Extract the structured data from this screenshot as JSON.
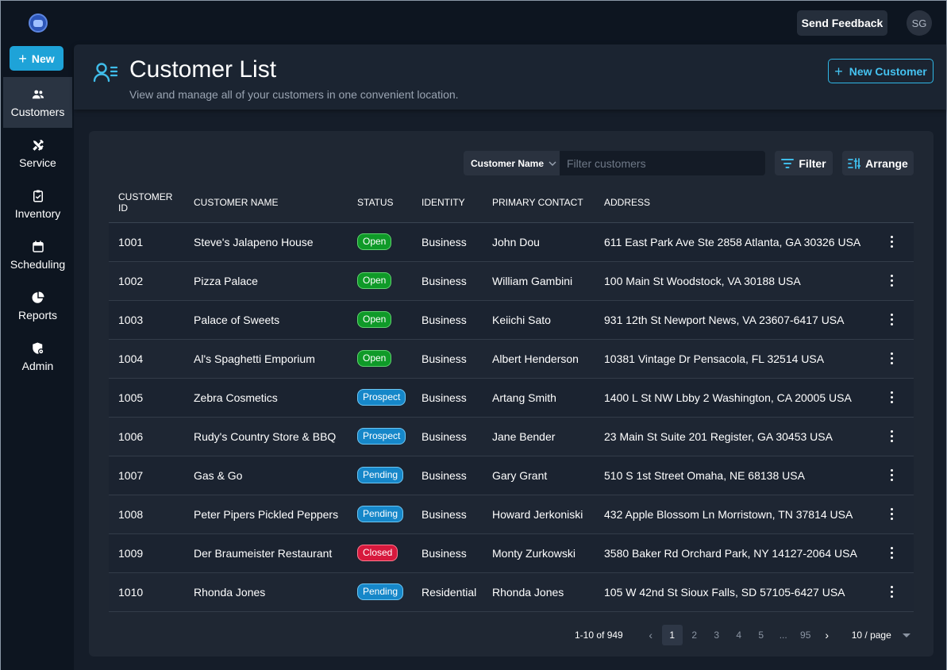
{
  "topbar": {
    "send_feedback": "Send Feedback",
    "avatar_initials": "SG"
  },
  "sidebar": {
    "new_button": "New",
    "items": [
      {
        "label": "Customers",
        "icon": "users-icon",
        "active": true
      },
      {
        "label": "Service",
        "icon": "tools-icon",
        "active": false
      },
      {
        "label": "Inventory",
        "icon": "clipboard-check-icon",
        "active": false
      },
      {
        "label": "Scheduling",
        "icon": "calendar-icon",
        "active": false
      },
      {
        "label": "Reports",
        "icon": "pie-chart-icon",
        "active": false
      },
      {
        "label": "Admin",
        "icon": "shield-gear-icon",
        "active": false
      }
    ]
  },
  "header": {
    "title": "Customer List",
    "subtitle": "View and manage all of your customers in one convenient location.",
    "new_customer": "New Customer"
  },
  "toolbar": {
    "search_field": "Customer Name",
    "search_placeholder": "Filter customers",
    "filter": "Filter",
    "arrange": "Arrange"
  },
  "table": {
    "columns": [
      "CUSTOMER ID",
      "CUSTOMER NAME",
      "STATUS",
      "IDENTITY",
      "PRIMARY CONTACT",
      "ADDRESS"
    ],
    "rows": [
      {
        "id": "1001",
        "name": "Steve's Jalapeno House",
        "status": "Open",
        "status_type": "open",
        "identity": "Business",
        "contact": "John Dou",
        "address": "611 East Park Ave Ste 2858 Atlanta, GA 30326 USA"
      },
      {
        "id": "1002",
        "name": "Pizza Palace",
        "status": "Open",
        "status_type": "open",
        "identity": "Business",
        "contact": "William Gambini",
        "address": "100 Main St Woodstock, VA 30188 USA"
      },
      {
        "id": "1003",
        "name": "Palace of Sweets",
        "status": "Open",
        "status_type": "open",
        "identity": "Business",
        "contact": "Keiichi Sato",
        "address": "931 12th St Newport News, VA 23607-6417 USA"
      },
      {
        "id": "1004",
        "name": "Al's Spaghetti Emporium",
        "status": "Open",
        "status_type": "open",
        "identity": "Business",
        "contact": "Albert Henderson",
        "address": "10381 Vintage Dr Pensacola, FL 32514 USA"
      },
      {
        "id": "1005",
        "name": "Zebra Cosmetics",
        "status": "Prospect",
        "status_type": "prospect",
        "identity": "Business",
        "contact": "Artang Smith",
        "address": "1400 L St NW Lbby 2 Washington, CA 20005 USA"
      },
      {
        "id": "1006",
        "name": "Rudy's Country Store & BBQ",
        "status": "Prospect",
        "status_type": "prospect",
        "identity": "Business",
        "contact": "Jane Bender",
        "address": "23 Main St Suite 201 Register, GA 30453 USA"
      },
      {
        "id": "1007",
        "name": "Gas & Go",
        "status": "Pending",
        "status_type": "pending",
        "identity": "Business",
        "contact": "Gary Grant",
        "address": "510 S 1st Street Omaha, NE 68138 USA"
      },
      {
        "id": "1008",
        "name": "Peter Pipers Pickled Peppers",
        "status": "Pending",
        "status_type": "pending",
        "identity": "Business",
        "contact": "Howard Jerkoniski",
        "address": "432 Apple Blossom Ln Morristown, TN 37814 USA"
      },
      {
        "id": "1009",
        "name": "Der Braumeister Restaurant",
        "status": "Closed",
        "status_type": "closed",
        "identity": "Business",
        "contact": "Monty Zurkowski",
        "address": "3580 Baker Rd Orchard Park, NY 14127-2064 USA"
      },
      {
        "id": "1010",
        "name": "Rhonda Jones",
        "status": "Pending",
        "status_type": "pending",
        "identity": "Residential",
        "contact": "Rhonda Jones",
        "address": "105 W 42nd St Sioux Falls, SD 57105-6427 USA"
      }
    ]
  },
  "pagination": {
    "total_text": "1-10 of 949",
    "pages": [
      "1",
      "2",
      "3",
      "4",
      "5",
      "...",
      "95"
    ],
    "current_page": "1",
    "page_size": "10 / page"
  },
  "colors": {
    "accent": "#1ea3d8",
    "open": "#0f9a28",
    "prospect": "#1687c9",
    "pending": "#1687c9",
    "closed": "#d7193d"
  }
}
